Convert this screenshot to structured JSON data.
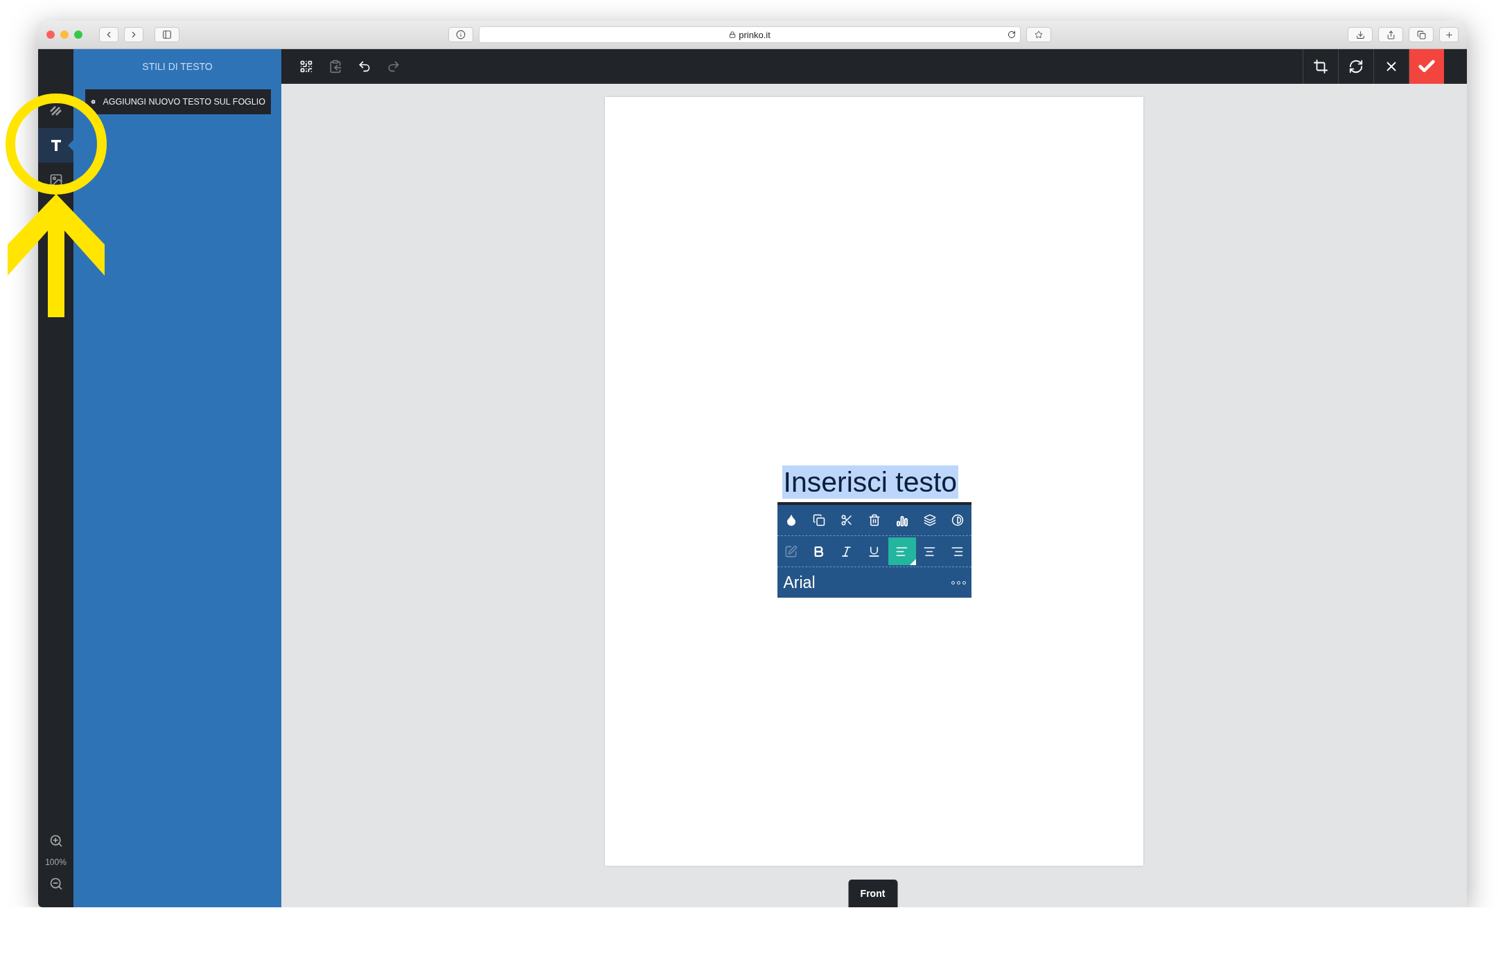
{
  "browser": {
    "url": "prinko.it"
  },
  "rail": {
    "items": [
      {
        "kind": "pattern",
        "selected": false
      },
      {
        "kind": "text",
        "selected": true
      },
      {
        "kind": "image",
        "selected": false
      }
    ],
    "zoom": "100%"
  },
  "panel": {
    "title": "STILI DI TESTO",
    "add_button": "AGGIUNGI NUOVO TESTO SUL FOGLIO"
  },
  "toolbar": {
    "left": [
      {
        "kind": "qr",
        "disabled": false
      },
      {
        "kind": "paste",
        "disabled": true
      },
      {
        "kind": "undo",
        "disabled": false
      },
      {
        "kind": "redo",
        "disabled": true
      }
    ],
    "right": [
      {
        "kind": "crop"
      },
      {
        "kind": "rotate"
      },
      {
        "kind": "close"
      },
      {
        "kind": "confirm"
      }
    ]
  },
  "canvas": {
    "text": "Inserisci testo",
    "text_selected": true,
    "editor": {
      "actions": [
        {
          "kind": "color"
        },
        {
          "kind": "duplicate"
        },
        {
          "kind": "cut"
        },
        {
          "kind": "delete"
        },
        {
          "kind": "chart"
        },
        {
          "kind": "layers"
        },
        {
          "kind": "contrast"
        }
      ],
      "format": [
        {
          "kind": "edit",
          "selected": false,
          "disabled": true
        },
        {
          "kind": "bold",
          "selected": false,
          "disabled": false
        },
        {
          "kind": "italic",
          "selected": false,
          "disabled": false
        },
        {
          "kind": "underline",
          "selected": false,
          "disabled": false
        },
        {
          "kind": "align-left",
          "selected": true,
          "disabled": false
        },
        {
          "kind": "align-center",
          "selected": false,
          "disabled": false
        },
        {
          "kind": "align-right",
          "selected": false,
          "disabled": false
        }
      ],
      "font": "Arial"
    },
    "page_tab": "Front"
  }
}
